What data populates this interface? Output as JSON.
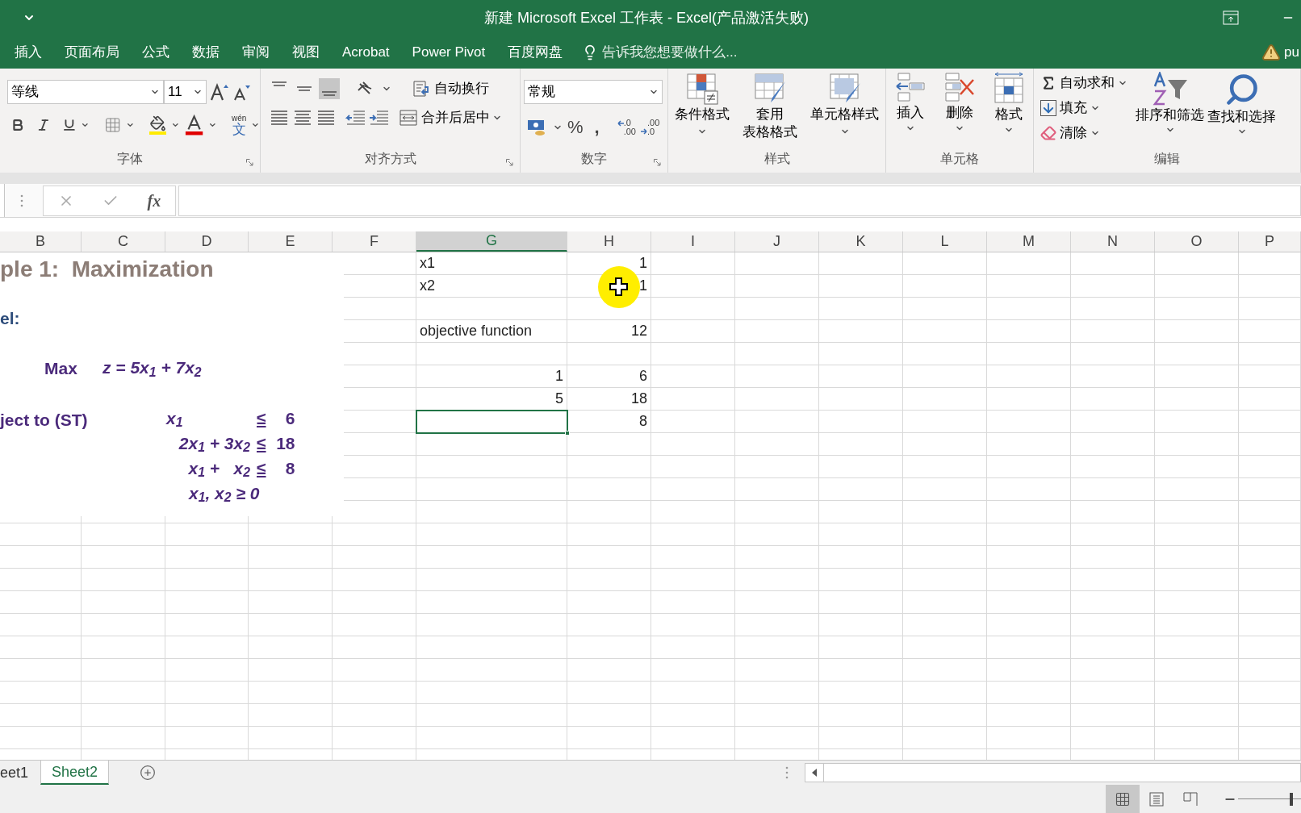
{
  "window": {
    "title": "新建 Microsoft Excel 工作表 - Excel(产品激活失败)"
  },
  "ribbon_tabs": [
    "插入",
    "页面布局",
    "公式",
    "数据",
    "审阅",
    "视图",
    "Acrobat",
    "Power Pivot",
    "百度网盘"
  ],
  "tell_me": "告诉我您想要做什么...",
  "account": "pu",
  "ribbon": {
    "font": {
      "label": "字体",
      "name": "等线",
      "size": "11",
      "phonetic_top": "wén",
      "phonetic_char": "文"
    },
    "alignment": {
      "label": "对齐方式",
      "wrap": "自动换行",
      "merge": "合并后居中"
    },
    "number": {
      "label": "数字",
      "format": "常规",
      "percent": "%",
      "comma": ",",
      "increase_decimal": [
        ".0",
        ".00"
      ],
      "decrease_decimal": [
        ".00",
        ".0"
      ]
    },
    "styles": {
      "label": "样式",
      "buttons": [
        {
          "lines": [
            "条件格式"
          ],
          "kind": "conditional"
        },
        {
          "lines": [
            "套用",
            "表格格式"
          ],
          "kind": "table"
        },
        {
          "lines": [
            "单元格样式"
          ],
          "kind": "cellstyle"
        }
      ]
    },
    "cells": {
      "label": "单元格",
      "buttons": [
        {
          "text": "插入",
          "kind": "insert"
        },
        {
          "text": "删除",
          "kind": "delete"
        },
        {
          "text": "格式",
          "kind": "format"
        }
      ]
    },
    "editing": {
      "label": "编辑",
      "small": [
        {
          "text": "自动求和",
          "kind": "sum"
        },
        {
          "text": "填充",
          "kind": "fill"
        },
        {
          "text": "清除",
          "kind": "clear"
        }
      ],
      "large": [
        {
          "text": "排序和筛选",
          "kind": "sort"
        },
        {
          "text": "查找和选择",
          "kind": "find"
        }
      ]
    }
  },
  "formula_bar": {
    "fx": "fx"
  },
  "sheet": {
    "columns": [
      {
        "letter": "B",
        "selected": false
      },
      {
        "letter": "C",
        "selected": false
      },
      {
        "letter": "D",
        "selected": false
      },
      {
        "letter": "E",
        "selected": false
      },
      {
        "letter": "F",
        "selected": false
      },
      {
        "letter": "G",
        "selected": true
      },
      {
        "letter": "H",
        "selected": false
      },
      {
        "letter": "I",
        "selected": false
      },
      {
        "letter": "J",
        "selected": false
      },
      {
        "letter": "K",
        "selected": false
      },
      {
        "letter": "L",
        "selected": false
      },
      {
        "letter": "M",
        "selected": false
      },
      {
        "letter": "N",
        "selected": false
      },
      {
        "letter": "O",
        "selected": false
      },
      {
        "letter": "P",
        "selected": false
      }
    ],
    "rows": [
      {
        "cells": [
          {
            "kind": "text",
            "text": "x1",
            "selected": false
          },
          {
            "kind": "number",
            "text": "1",
            "selected": false
          }
        ]
      },
      {
        "cells": [
          {
            "kind": "text",
            "text": "x2",
            "selected": false
          },
          {
            "kind": "number",
            "text": "1",
            "selected": false
          }
        ]
      },
      {
        "cells": [
          {
            "kind": "empty",
            "selected": false
          },
          {
            "kind": "empty",
            "selected": false
          }
        ]
      },
      {
        "cells": [
          {
            "kind": "text",
            "text": "objective function",
            "selected": false
          },
          {
            "kind": "number",
            "text": "12",
            "selected": false
          }
        ]
      },
      {
        "cells": [
          {
            "kind": "empty",
            "selected": false
          },
          {
            "kind": "empty",
            "selected": false
          }
        ]
      },
      {
        "cells": [
          {
            "kind": "number",
            "text": "1",
            "selected": false
          },
          {
            "kind": "number",
            "text": "6",
            "selected": false
          }
        ]
      },
      {
        "cells": [
          {
            "kind": "number",
            "text": "5",
            "selected": false
          },
          {
            "kind": "number",
            "text": "18",
            "selected": false
          }
        ]
      },
      {
        "cells": [
          {
            "kind": "empty",
            "selected": true
          },
          {
            "kind": "number",
            "text": "8",
            "selected": false
          }
        ]
      }
    ],
    "embedded_image": {
      "title": "ple 1:  Maximization",
      "model_label": "el:",
      "objective_word": "Max",
      "objective": "z = 5x$_{1}$ + 7x$_{2}$",
      "subject_to": "ject to (ST)",
      "constraints": [
        {
          "kind": "inequality",
          "lhs": "x$_{1}$",
          "op": "≤",
          "rhs": "6"
        },
        {
          "kind": "inequality",
          "lhs": "2x$_{1}$ + 3x$_{2}$",
          "op": "≤",
          "rhs": "18"
        },
        {
          "kind": "inequality",
          "lhs": "x$_{1}$ +   x$_{2}$",
          "op": "≤",
          "rhs": "8"
        },
        {
          "kind": "condition",
          "text": "x$_{1}$, x$_{2}$ ≥ 0"
        }
      ]
    }
  },
  "sheet_tabs": [
    {
      "label": "eet1",
      "selected": false
    },
    {
      "label": "Sheet2",
      "selected": true
    }
  ],
  "status_bar": {
    "views": [
      {
        "kind": "normal",
        "selected": true
      },
      {
        "kind": "page_layout",
        "selected": false
      },
      {
        "kind": "page_break",
        "selected": false
      }
    ],
    "zoom": {
      "level": 0.85
    }
  }
}
